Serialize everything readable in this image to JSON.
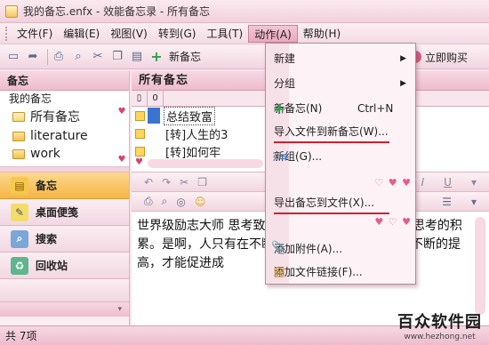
{
  "window": {
    "title": "我的备忘.enfx - 效能备忘录 - 所有备忘"
  },
  "menubar": {
    "items": [
      "文件(F)",
      "编辑(E)",
      "视图(V)",
      "转到(G)",
      "工具(T)",
      "动作(A)",
      "帮助(H)"
    ],
    "active_index": 5
  },
  "toolbar": {
    "new_note": "新备忘",
    "buy": "立即购买"
  },
  "left": {
    "header": "备忘",
    "tree_root": "我的备忘",
    "tree_items": [
      "所有备忘",
      "literature",
      "work"
    ],
    "nav": [
      "备忘",
      "桌面便笺",
      "搜索",
      "回收站"
    ]
  },
  "right": {
    "header": "所有备忘",
    "rows": [
      "总结致富",
      "[转]人生的3",
      "[转]如何牢"
    ],
    "editor_text": "世界级励志大师 思考致富》，影响 到：成功是一种思考的积累。是啊，人只有在不断的思考不断的实践中才能不断的提高，才能促进成"
  },
  "status": {
    "count": "共 7项"
  },
  "watermark": {
    "name": "百众软件园",
    "url": "www.hezhong.net"
  },
  "dropdown": {
    "items": [
      {
        "label": "新建",
        "submenu": true
      },
      {
        "label": "分组",
        "submenu": true
      },
      {
        "label": "新备忘(N)",
        "shortcut": "Ctrl+N"
      },
      {
        "label": "导入文件到新备忘(W)..."
      },
      {
        "label": "新组(G)..."
      },
      {
        "label": "导出备忘到文件(X)..."
      },
      {
        "label": "添加附件(A)..."
      },
      {
        "label": "添加文件链接(F)..."
      }
    ]
  },
  "colors": {
    "accent": "#d21f2f",
    "selection": "#3b74cf",
    "theme_pink": "#eebcce"
  }
}
